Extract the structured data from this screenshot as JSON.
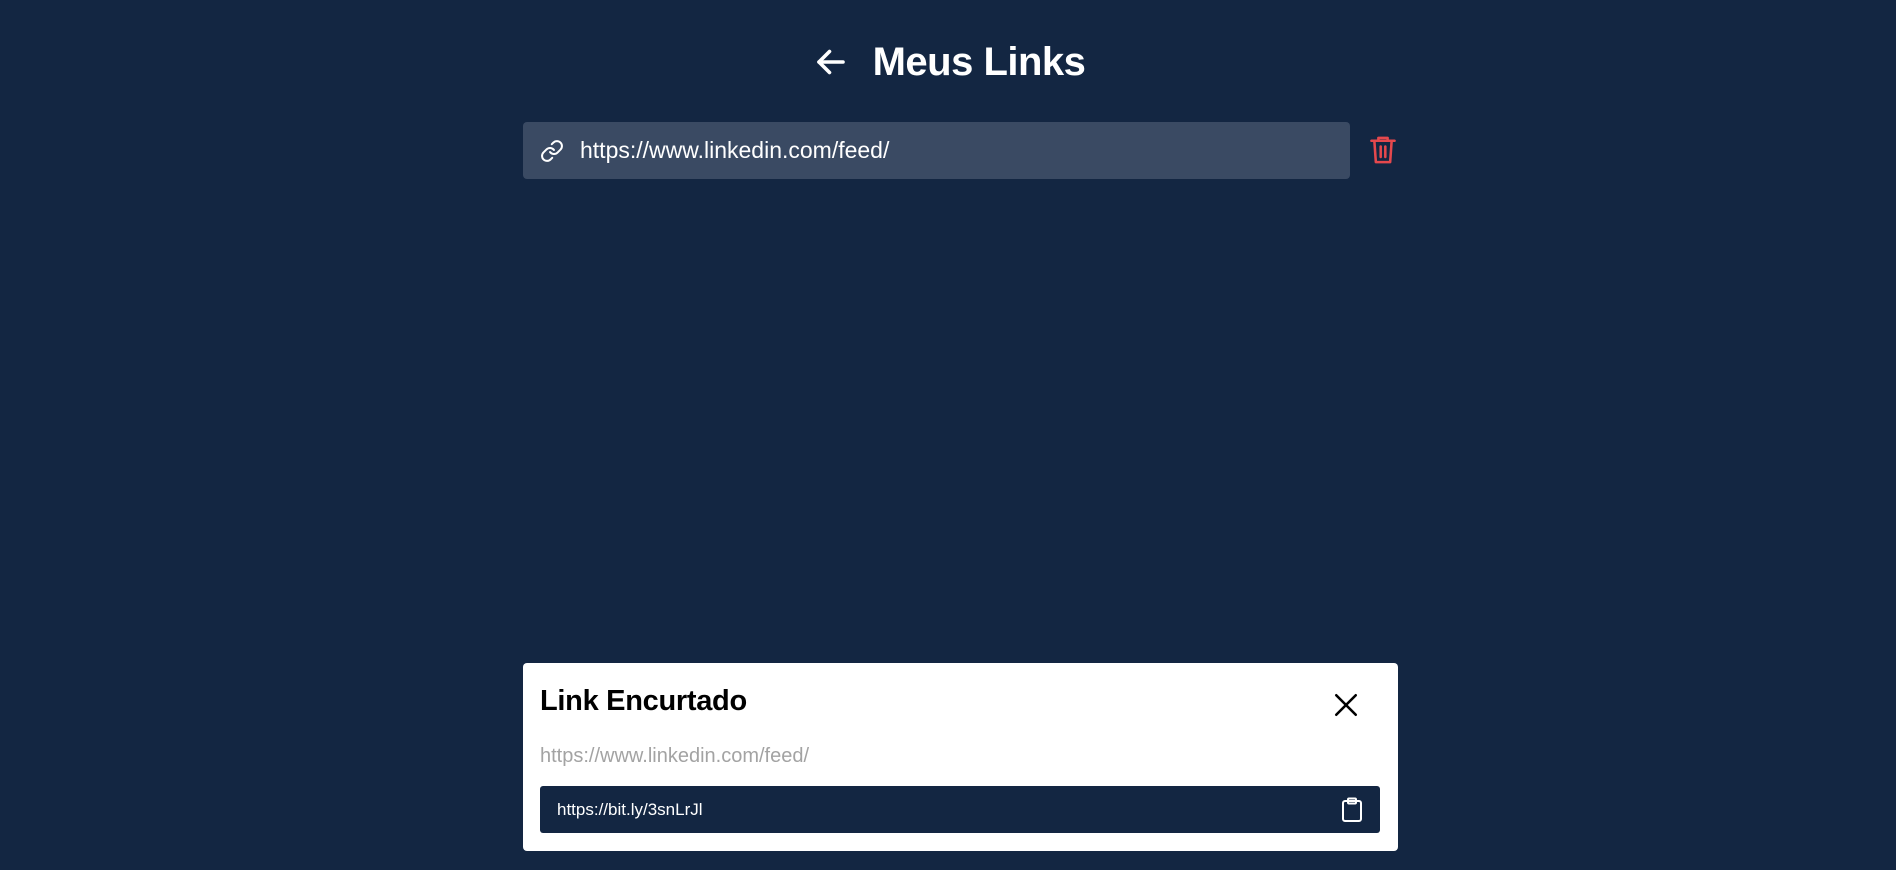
{
  "header": {
    "title": "Meus Links",
    "back_icon": "arrow-left-icon"
  },
  "links": [
    {
      "url": "https://www.linkedin.com/feed/",
      "icon": "link-icon"
    }
  ],
  "modal": {
    "title": "Link Encurtado",
    "original_url": "https://www.linkedin.com/feed/",
    "short_url": "https://bit.ly/3snLrJl",
    "close_icon": "close-icon",
    "copy_icon": "clipboard-icon"
  },
  "colors": {
    "background": "#132642",
    "link_row": "#3a4a63",
    "delete": "#e5484d",
    "modal_bg": "#ffffff"
  }
}
